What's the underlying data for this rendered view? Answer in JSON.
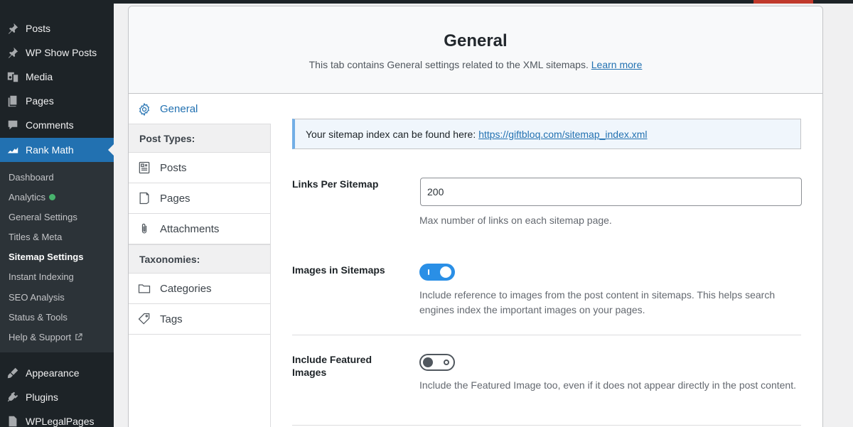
{
  "admin_menu": {
    "top_items": [
      {
        "label": "Posts",
        "icon": "pin-icon"
      },
      {
        "label": "WP Show Posts",
        "icon": "pin-icon"
      },
      {
        "label": "Media",
        "icon": "media-icon"
      },
      {
        "label": "Pages",
        "icon": "pages-icon"
      },
      {
        "label": "Comments",
        "icon": "comments-icon"
      },
      {
        "label": "Rank Math",
        "icon": "rank-math-icon"
      }
    ],
    "submenu": [
      {
        "label": "Dashboard"
      },
      {
        "label": "Analytics"
      },
      {
        "label": "General Settings"
      },
      {
        "label": "Titles & Meta"
      },
      {
        "label": "Sitemap Settings"
      },
      {
        "label": "Instant Indexing"
      },
      {
        "label": "SEO Analysis"
      },
      {
        "label": "Status & Tools"
      },
      {
        "label": "Help & Support"
      }
    ],
    "bottom_items": [
      {
        "label": "Appearance",
        "icon": "appearance-icon"
      },
      {
        "label": "Plugins",
        "icon": "plugins-icon"
      },
      {
        "label": "WPLegalPages",
        "icon": "document-icon"
      }
    ]
  },
  "header": {
    "title": "General",
    "description": "This tab contains General settings related to the XML sitemaps.",
    "learn_more": "Learn more"
  },
  "tabs": {
    "general": "General",
    "post_types_heading": "Post Types:",
    "posts": "Posts",
    "pages": "Pages",
    "attachments": "Attachments",
    "taxonomies_heading": "Taxonomies:",
    "categories": "Categories",
    "tags": "Tags"
  },
  "content": {
    "notice_text": "Your sitemap index can be found here:",
    "notice_link": "https://giftbloq.com/sitemap_index.xml",
    "links_per_sitemap": {
      "label": "Links Per Sitemap",
      "value": "200",
      "help": "Max number of links on each sitemap page."
    },
    "images_in_sitemaps": {
      "label": "Images in Sitemaps",
      "state": "on",
      "help": "Include reference to images from the post content in sitemaps. This helps search engines index the important images on your pages."
    },
    "include_featured_images": {
      "label": "Include Featured Images",
      "state": "off",
      "help": "Include the Featured Image too, even if it does not appear directly in the post content."
    }
  },
  "colors": {
    "admin_bg": "#1d2327",
    "accent": "#2271b1",
    "toggle_on": "#2a8fe6",
    "analytics_dot": "#48b36d"
  }
}
